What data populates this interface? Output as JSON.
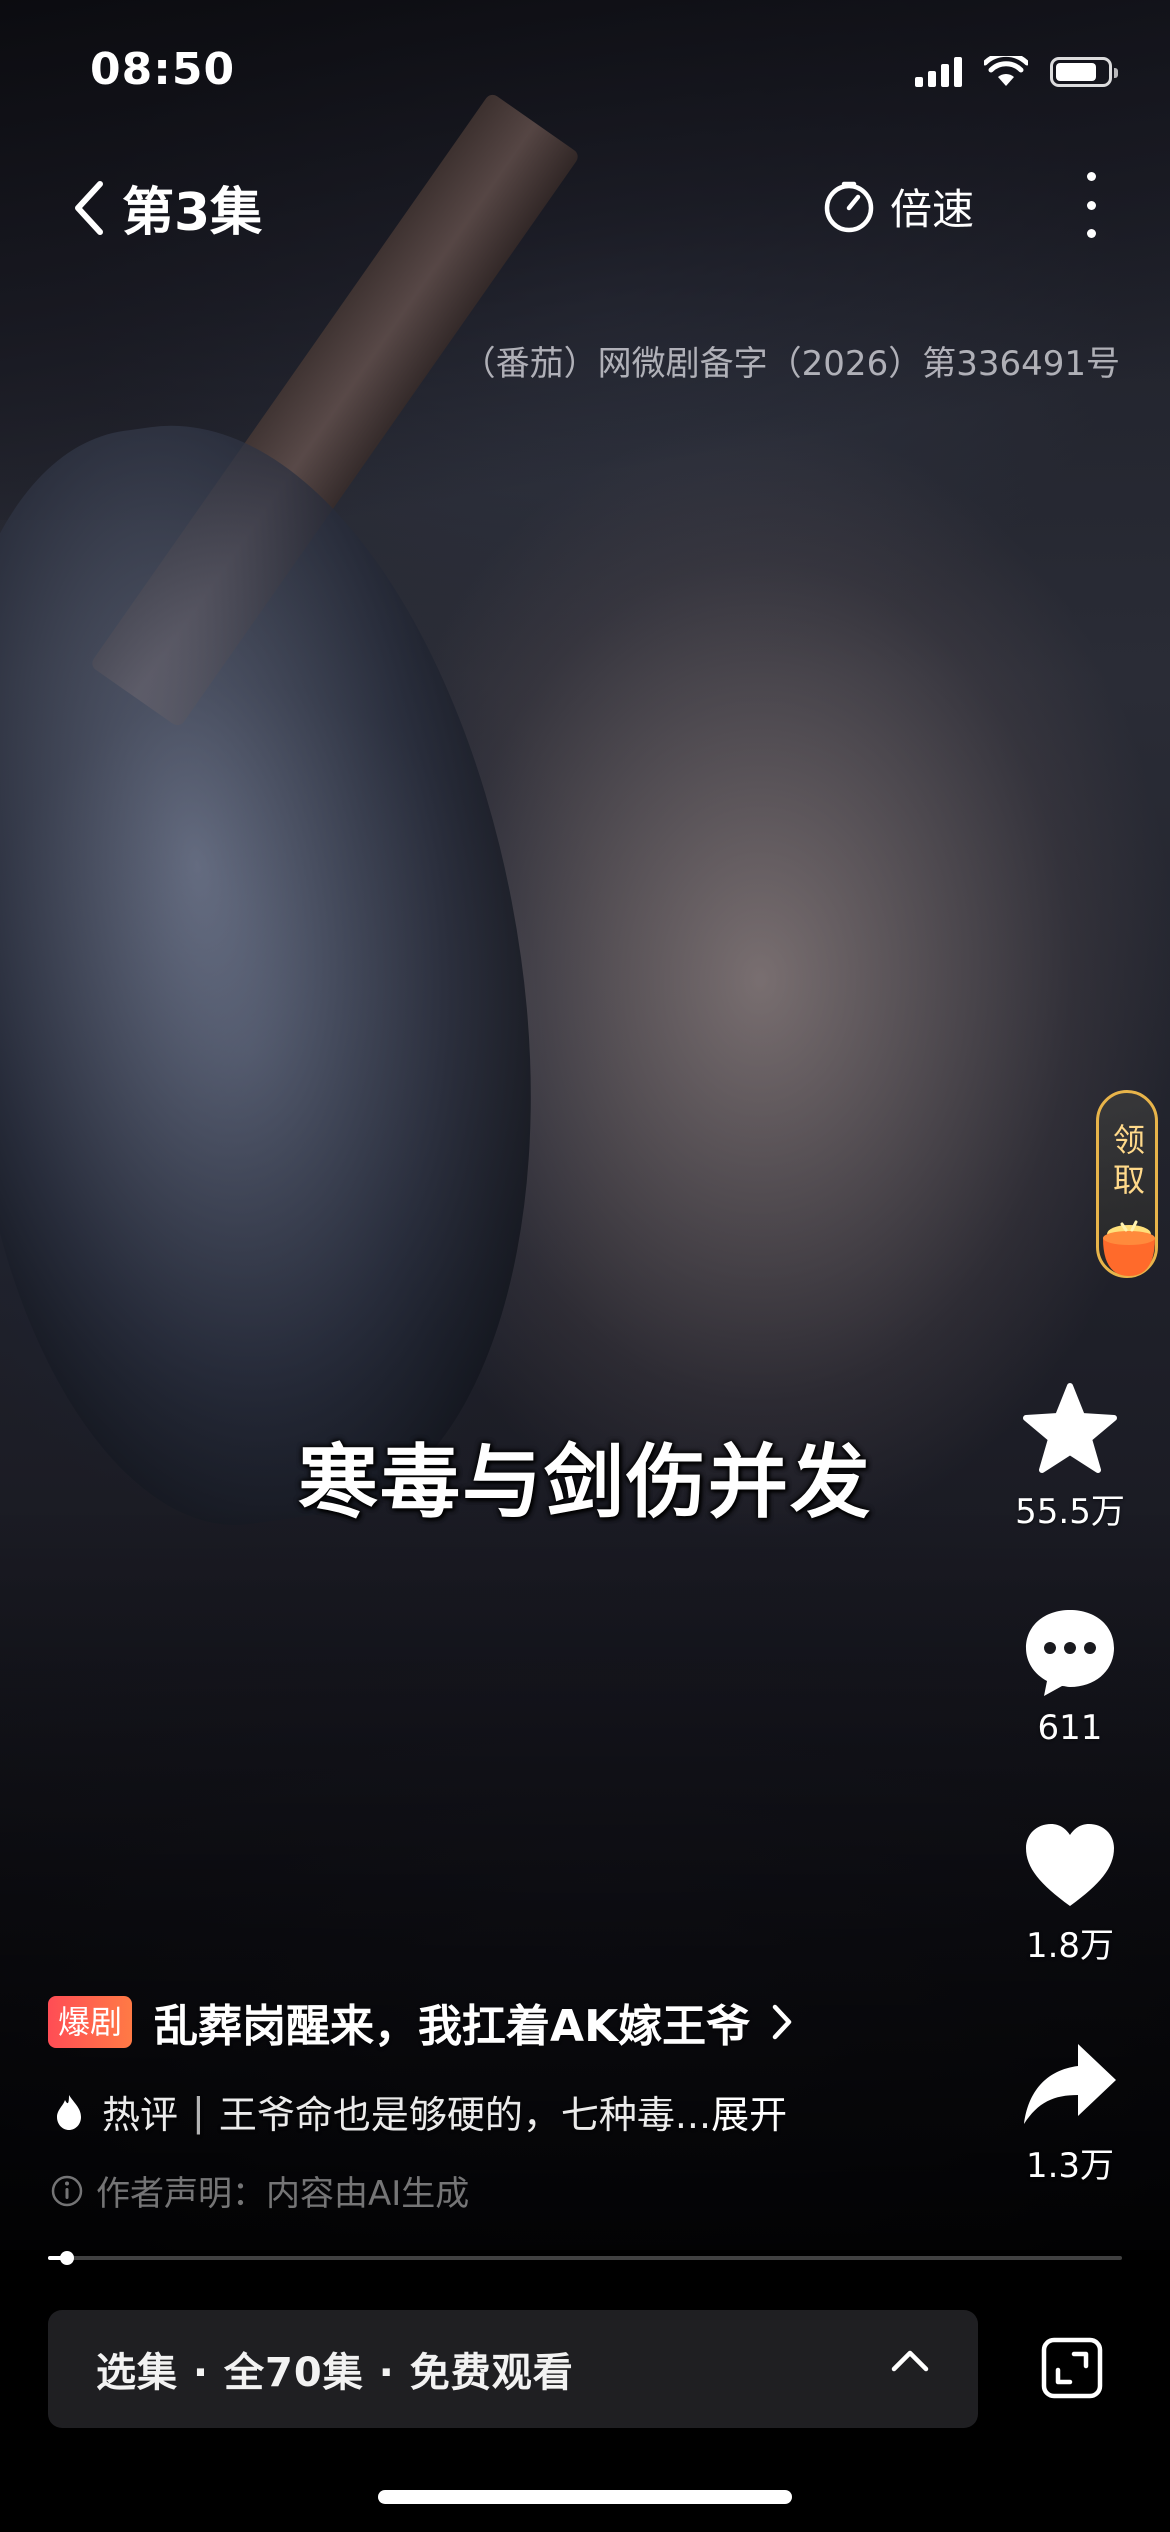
{
  "status_bar": {
    "time": "08:50",
    "signal_icon": "signal-icon",
    "wifi_icon": "wifi-icon",
    "battery_icon": "battery-icon"
  },
  "top_nav": {
    "back_icon": "chevron-left-icon",
    "episode_title": "第3集",
    "speed_icon": "timer-icon",
    "speed_label": "倍速",
    "more_icon": "more-vertical-icon"
  },
  "license_text": "（番茄）网微剧备字（2026）第336491号",
  "subtitle": "寒毒与剑伤并发",
  "reward": {
    "label": "领取",
    "icon": "coin-pot-icon",
    "accent_color": "#e8b44a"
  },
  "actions": {
    "favorite": {
      "icon": "star-icon",
      "count": "55.5万"
    },
    "comment": {
      "icon": "comment-icon",
      "count": "611"
    },
    "like": {
      "icon": "heart-icon",
      "count": "1.8万"
    },
    "share": {
      "icon": "share-icon",
      "count": "1.3万"
    }
  },
  "drama": {
    "badge": "爆剧",
    "badge_color": "#ff4d55",
    "title": "乱葬岗醒来，我扛着AK嫁王爷",
    "chevron_icon": "chevron-right-icon"
  },
  "hot_comment": {
    "icon": "flame-icon",
    "label": "热评",
    "separator": "|",
    "text": "王爷命也是够硬的，七种毒...",
    "expand_label": "展开"
  },
  "ai_notice": {
    "icon": "info-icon",
    "text": "作者声明：内容由AI生成"
  },
  "progress": {
    "fraction": 0.018
  },
  "episode_bar": {
    "text": "选集 · 全70集 · 免费观看",
    "chevron_icon": "chevron-up-icon",
    "fullscreen_icon": "fullscreen-icon"
  }
}
